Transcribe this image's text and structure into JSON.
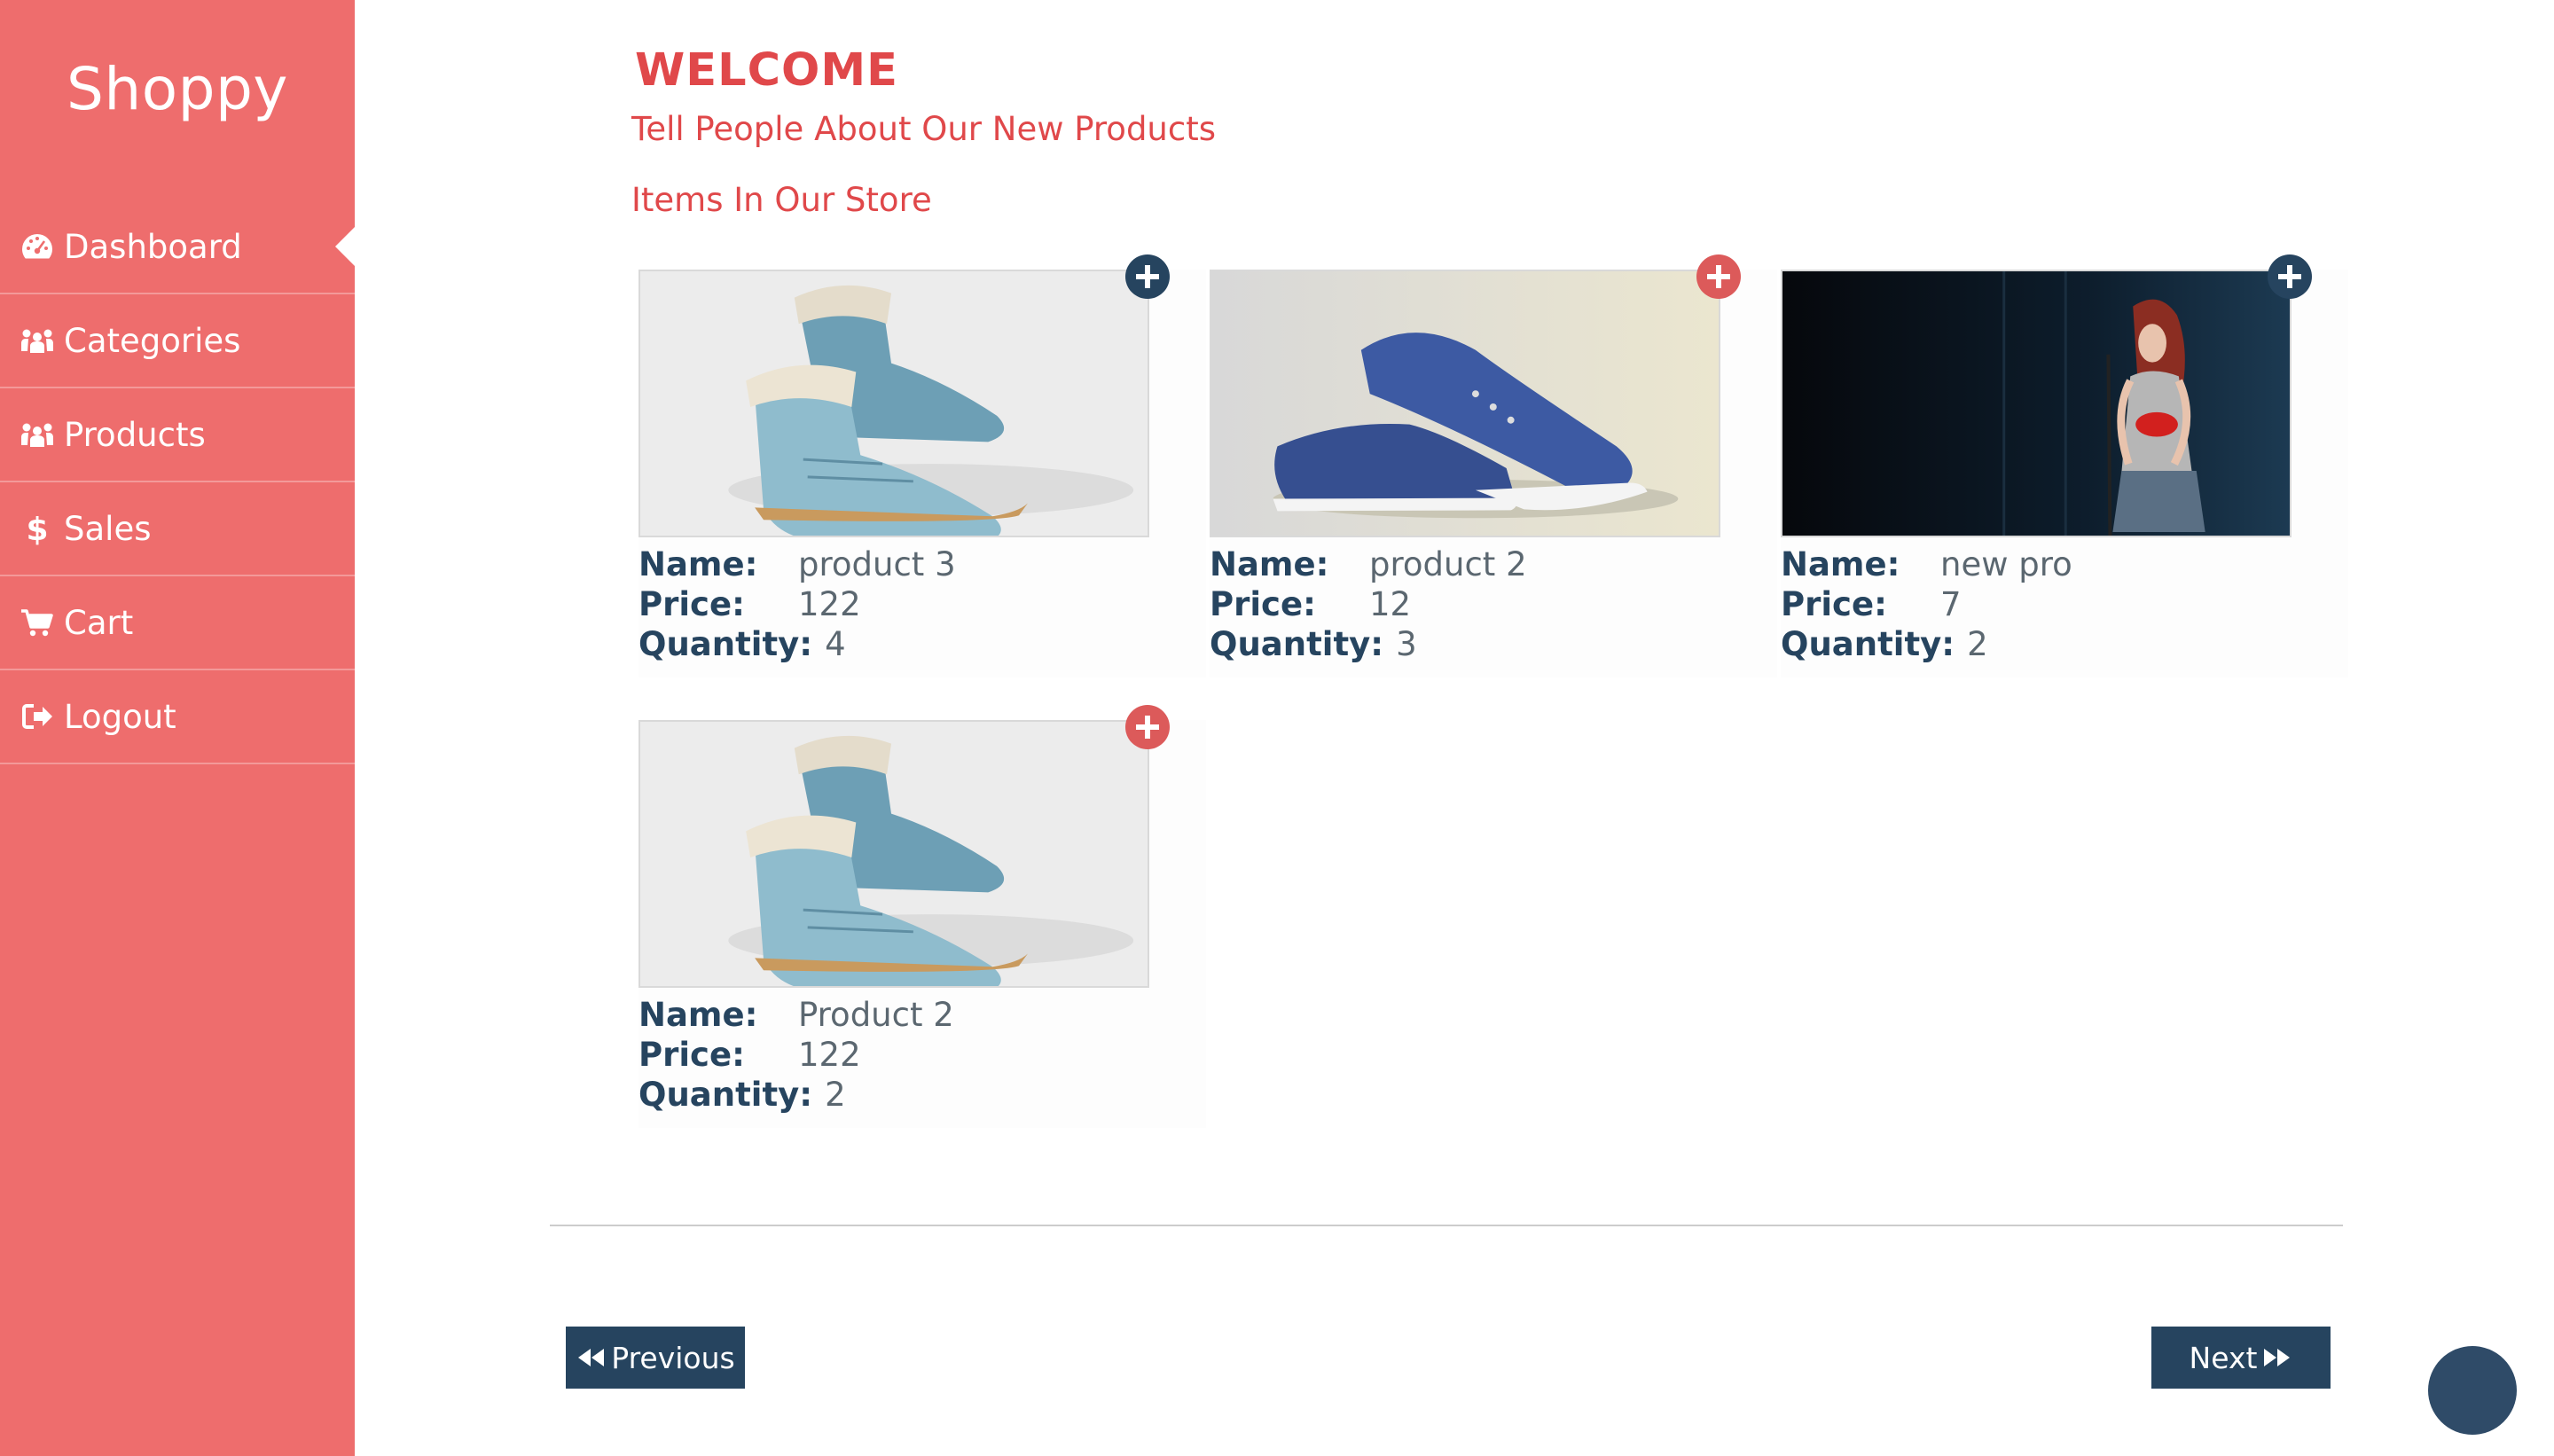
{
  "app": {
    "brand": "Shoppy"
  },
  "sidebar": {
    "items": [
      {
        "label": "Dashboard",
        "icon": "dashboard-icon",
        "active": true
      },
      {
        "label": "Categories",
        "icon": "users-icon"
      },
      {
        "label": "Products",
        "icon": "users-icon"
      },
      {
        "label": "Sales",
        "icon": "dollar-icon"
      },
      {
        "label": "Cart",
        "icon": "cart-icon"
      },
      {
        "label": "Logout",
        "icon": "sign-out-icon"
      }
    ]
  },
  "main": {
    "heading": "WELCOME",
    "tagline": "Tell People About Our New Products",
    "section_title": "Items In Our Store",
    "labels": {
      "name": "Name:",
      "price": "Price:",
      "quantity": "Quantity:"
    },
    "products": [
      {
        "name": "product 3",
        "price": "122",
        "quantity": "4",
        "image": "blue-boots-photo",
        "add_icon": "plus-circle-icon",
        "add_color": "#26445f"
      },
      {
        "name": "product 2",
        "price": "12",
        "quantity": "3",
        "image": "blue-sneakers-photo",
        "add_icon": "plus-circle-icon",
        "add_color": "#dc5a5a"
      },
      {
        "name": "new pro",
        "price": "7",
        "quantity": "2",
        "image": "singer-concert-photo",
        "add_icon": "plus-circle-icon",
        "add_color": "#26445f"
      },
      {
        "name": "Product 2",
        "price": "122",
        "quantity": "2",
        "image": "blue-boots-photo",
        "add_icon": "plus-circle-icon",
        "add_color": "#dc5a5a"
      }
    ]
  },
  "pager": {
    "previous": "Previous",
    "next": "Next"
  },
  "colors": {
    "sidebar": "#ee6d6d",
    "accent": "#e0484a",
    "navy": "#26445f"
  }
}
